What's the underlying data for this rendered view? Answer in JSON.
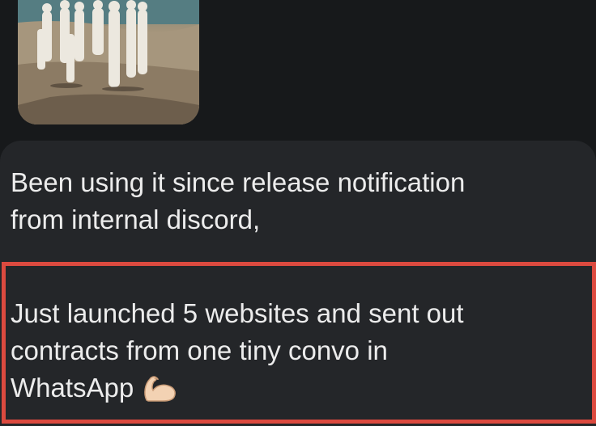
{
  "chat": {
    "photo": {
      "icon": "beach-group-photo"
    },
    "message": {
      "line1": "Been using it since release notification",
      "line2": "from internal discord,",
      "line3": "Just launched 5 websites and sent out",
      "line4": "contracts from one tiny convo in",
      "line5": "WhatsApp",
      "emoji": "flexed-biceps-icon"
    },
    "highlight_color": "#dc4a3f",
    "bubble_color": "#242629"
  }
}
